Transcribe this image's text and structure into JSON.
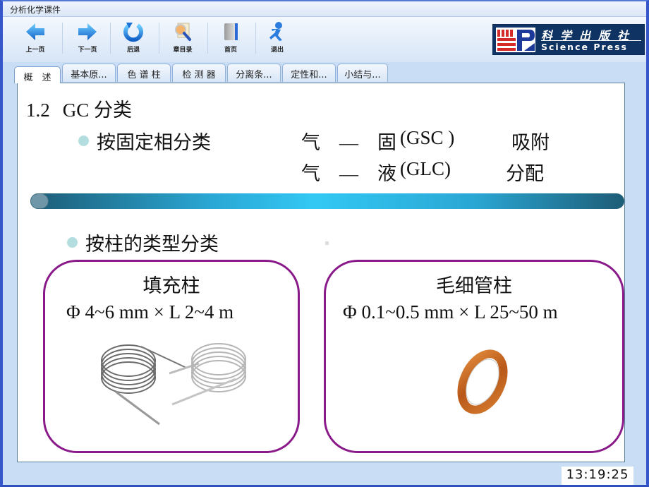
{
  "window": {
    "title": "分析化学课件"
  },
  "toolbar": {
    "buttons": [
      {
        "label": "上一页",
        "icon": "arrow-left-icon"
      },
      {
        "label": "下一页",
        "icon": "arrow-right-icon"
      },
      {
        "label": "后退",
        "icon": "undo-icon"
      },
      {
        "label": "章目录",
        "icon": "magnifier-document-icon"
      },
      {
        "label": "首页",
        "icon": "book-icon"
      },
      {
        "label": "退出",
        "icon": "running-person-icon"
      }
    ],
    "logo": {
      "cn": "科学出版社",
      "en": "Science Press",
      "brand_color": "#0f3363",
      "mark_red": "#d42a2a",
      "mark_blue": "#1d3a9a"
    }
  },
  "tabs": [
    {
      "label": "概　述",
      "active": true
    },
    {
      "label": "基本原...",
      "active": false
    },
    {
      "label": "色 谱 柱",
      "active": false
    },
    {
      "label": "检 测 器",
      "active": false
    },
    {
      "label": "分离条...",
      "active": false
    },
    {
      "label": "定性和...",
      "active": false
    },
    {
      "label": "小结与...",
      "active": false
    }
  ],
  "slide": {
    "heading_num": "1.2",
    "heading_text": "GC 分类",
    "bullet1": "按固定相分类",
    "phases": [
      {
        "type": "气　—　固",
        "abbr": "(GSC )",
        "mechanism": "吸附"
      },
      {
        "type": "气　—　液",
        "abbr": "(GLC)",
        "mechanism": "分配"
      }
    ],
    "bullet2": "按柱的类型分类",
    "columns": [
      {
        "title": "填充柱",
        "spec": "Φ 4~6 mm × L 2~4 m",
        "image": "packed-column-coil"
      },
      {
        "title": "毛细管柱",
        "spec": "Φ 0.1~0.5 mm × L 25~50 m",
        "image": "capillary-column-ring"
      }
    ],
    "accent_colors": {
      "card_border": "#8a1a8a",
      "bullet": "#b4dde0",
      "bar_mid": "#33c8f4",
      "bar_end": "#1d5c76"
    }
  },
  "status": {
    "clock": "13:19:25"
  }
}
